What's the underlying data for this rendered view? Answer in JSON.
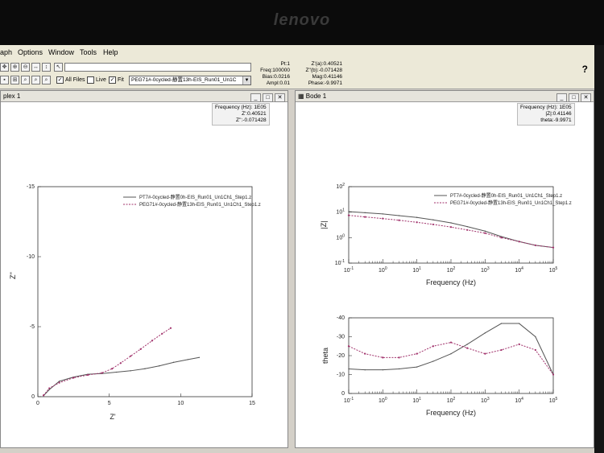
{
  "bezel": {
    "brand": "lenovo"
  },
  "menu": [
    "aph",
    "Options",
    "Window",
    "Tools",
    "Help"
  ],
  "toolbar": {
    "all_files_label": "All Files",
    "live_label": "Live",
    "fit_label": "Fit",
    "file_combo_value": "PEG71#-0cycled-静置13h-EIS_Run01_Un1C"
  },
  "readouts": {
    "pt": "Pt:1",
    "freq": "Freq:100000",
    "bias": "Bias:0.0216",
    "ampl": "Ampl:0.01",
    "zre": "Z'(a):0.40521",
    "zim": "Z''(b):-0.071428",
    "mag": "Mag:0.41146",
    "phase": "Phase:-9.9971"
  },
  "help_symbol": "?",
  "complex_panel": {
    "title": "plex 1",
    "info": [
      "Frequency (Hz): 1E05",
      "Z':0.40521",
      "Z'':-0.071428"
    ]
  },
  "bode_panel": {
    "title": "Bode 1",
    "info": [
      "Frequency (Hz): 1E05",
      "|Z|:0.41146",
      "theta:-9.9971"
    ]
  },
  "legend": {
    "series1": "PT7#-0cycled-静置0h-EIS_Run01_Un1Ch1_Step1.z",
    "series2": "PEG71#-0cycled-静置13h-EIS_Run01_Un1Ch1_Step1.z"
  },
  "colors": {
    "series1": "#555555",
    "series2": "#a0306a"
  },
  "chart_data": [
    {
      "type": "line",
      "title": "",
      "xlabel": "Z'",
      "ylabel": "Z''",
      "xlim": [
        0,
        15
      ],
      "ylim": [
        0,
        -15
      ],
      "x_ticks": [
        "0",
        "5",
        "10",
        "15"
      ],
      "y_ticks": [
        "0",
        "-5",
        "-10",
        "-15"
      ],
      "series": [
        {
          "name": "PT7#-0cycled-静置0h-EIS_Run01_Un1Ch1_Step1.z",
          "x": [
            0.4,
            0.8,
            1.5,
            2.5,
            3.5,
            4.5,
            5.5,
            6.5,
            7.5,
            8.5,
            9.5,
            10.5,
            11.3
          ],
          "y": [
            -0.07,
            -0.5,
            -1.1,
            -1.4,
            -1.6,
            -1.65,
            -1.75,
            -1.85,
            -2.0,
            -2.2,
            -2.45,
            -2.65,
            -2.8
          ]
        },
        {
          "name": "PEG71#-0cycled-静置13h-EIS_Run01_Un1Ch1_Step1.z",
          "x": [
            0.4,
            0.8,
            1.5,
            2.5,
            3.5,
            4.5,
            5.2,
            5.8,
            6.5,
            7.2,
            8.0,
            8.7,
            9.3
          ],
          "y": [
            -0.1,
            -0.6,
            -1.0,
            -1.35,
            -1.55,
            -1.7,
            -2.0,
            -2.4,
            -2.9,
            -3.4,
            -4.0,
            -4.5,
            -4.9
          ]
        }
      ]
    },
    {
      "type": "line",
      "title": "",
      "xlabel": "Frequency (Hz)",
      "ylabel": "|Z|",
      "log_x": true,
      "log_y": true,
      "x_ticks": [
        "10-1",
        "100",
        "101",
        "102",
        "103",
        "104",
        "105"
      ],
      "y_ticks": [
        "10-1",
        "100",
        "101",
        "102"
      ],
      "series": [
        {
          "name": "PT7#-0cycled-静置0h-EIS_Run01_Un1Ch1_Step1.z",
          "x": [
            0.1,
            0.3,
            1,
            3,
            10,
            30,
            100,
            300,
            1000,
            3000,
            10000,
            30000,
            100000
          ],
          "y": [
            10.5,
            9.5,
            8.5,
            7.3,
            6.2,
            5.0,
            3.8,
            2.7,
            1.8,
            1.1,
            0.7,
            0.5,
            0.41
          ]
        },
        {
          "name": "PEG71#-0cycled-静置13h-EIS_Run01_Un1Ch1_Step1.z",
          "x": [
            0.1,
            0.3,
            1,
            3,
            10,
            30,
            100,
            300,
            1000,
            3000,
            10000,
            30000,
            100000
          ],
          "y": [
            7.5,
            6.5,
            5.6,
            4.8,
            4.0,
            3.3,
            2.6,
            2.0,
            1.5,
            1.0,
            0.7,
            0.5,
            0.41
          ]
        }
      ]
    },
    {
      "type": "line",
      "title": "",
      "xlabel": "Frequency (Hz)",
      "ylabel": "theta",
      "log_x": true,
      "ylim": [
        0,
        -40
      ],
      "x_ticks": [
        "10-1",
        "100",
        "101",
        "102",
        "103",
        "104",
        "105"
      ],
      "y_ticks": [
        "0",
        "-10",
        "-20",
        "-30",
        "-40"
      ],
      "series": [
        {
          "name": "PT7#-0cycled-静置0h-EIS_Run01_Un1Ch1_Step1.z",
          "x": [
            0.1,
            0.3,
            1,
            3,
            10,
            30,
            100,
            300,
            1000,
            3000,
            10000,
            30000,
            100000
          ],
          "y": [
            -13,
            -12.5,
            -12.5,
            -13,
            -14,
            -17,
            -21,
            -26,
            -32,
            -37,
            -37,
            -30,
            -10
          ]
        },
        {
          "name": "PEG71#-0cycled-静置13h-EIS_Run01_Un1Ch1_Step1.z",
          "x": [
            0.1,
            0.3,
            1,
            3,
            10,
            30,
            100,
            300,
            1000,
            3000,
            10000,
            30000,
            100000
          ],
          "y": [
            -25,
            -21,
            -19,
            -19,
            -21,
            -25,
            -27,
            -24,
            -21,
            -23,
            -26,
            -23,
            -10
          ]
        }
      ]
    }
  ]
}
